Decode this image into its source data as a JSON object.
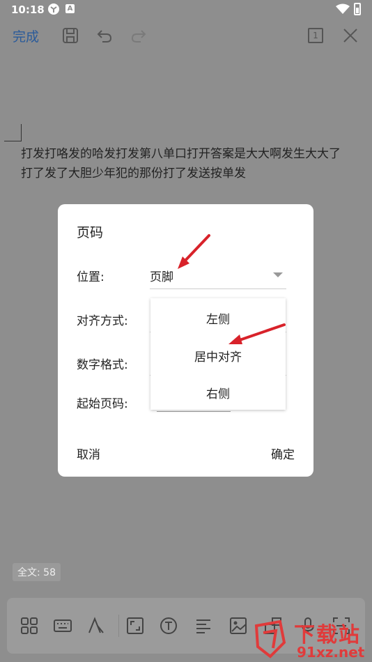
{
  "status": {
    "time": "10:18",
    "icon_b": "A"
  },
  "toolbar": {
    "done_label": "完成",
    "page_badge": "1",
    "icons": [
      "save-icon",
      "undo-icon",
      "redo-icon",
      "page-count-icon",
      "close-icon"
    ]
  },
  "document": {
    "line1": "打发打咯发的哈发打发第八单口打开答案是大大啊发生大大了",
    "line2": "打了发了大胆少年犯的那份打了发送按单发"
  },
  "dialog": {
    "title": "页码",
    "position_label": "位置:",
    "position_value": "页脚",
    "align_label": "对齐方式:",
    "number_format_label": "数字格式:",
    "start_page_label": "起始页码:",
    "cancel_label": "取消",
    "ok_label": "确定"
  },
  "dropdown": {
    "options": [
      "左侧",
      "居中对齐",
      "右侧"
    ]
  },
  "footer": {
    "word_count": "全文: 58"
  },
  "watermark": {
    "text_top": "下载站",
    "text_bottom": "91xz.net"
  },
  "colors": {
    "overlay_bg": "#8e8e8e",
    "accent": "#2a5b9a",
    "arrow": "#d8222a"
  }
}
